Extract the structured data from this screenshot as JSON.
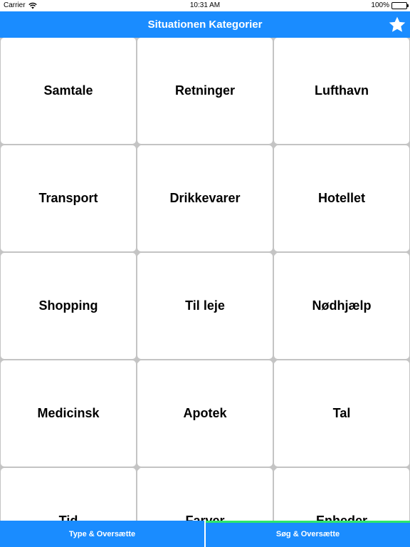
{
  "status_bar": {
    "carrier": "Carrier",
    "time": "10:31 AM",
    "battery": "100%"
  },
  "nav": {
    "title": "Situationen Kategorier",
    "favorites_icon": "star-icon"
  },
  "categories": [
    "Samtale",
    "Retninger",
    "Lufthavn",
    "Transport",
    "Drikkevarer",
    "Hotellet",
    "Shopping",
    "Til leje",
    "Nødhjælp",
    "Medicinsk",
    "Apotek",
    "Tal",
    "Tid",
    "Farver",
    "Enheder"
  ],
  "tabs": [
    {
      "label": "Type & Oversætte",
      "active": false
    },
    {
      "label": "Søg & Oversætte",
      "active": true
    }
  ],
  "colors": {
    "accent": "#1a8cff",
    "active_tab_indicator": "#2ee86a",
    "grid_background": "#c4c4c4"
  }
}
